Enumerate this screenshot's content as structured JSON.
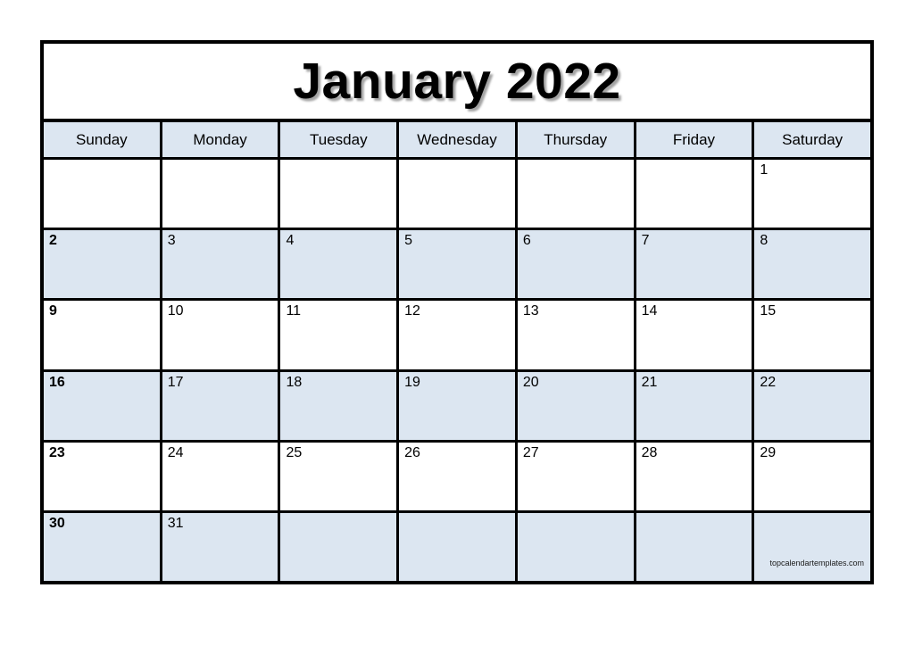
{
  "calendar": {
    "title": "January 2022",
    "month": "January",
    "year": "2022",
    "weekday_headers": [
      "Sunday",
      "Monday",
      "Tuesday",
      "Wednesday",
      "Thursday",
      "Friday",
      "Saturday"
    ],
    "weeks": [
      {
        "shaded": false,
        "days": [
          "",
          "",
          "",
          "",
          "",
          "",
          "1"
        ]
      },
      {
        "shaded": true,
        "days": [
          "2",
          "3",
          "4",
          "5",
          "6",
          "7",
          "8"
        ]
      },
      {
        "shaded": false,
        "days": [
          "9",
          "10",
          "11",
          "12",
          "13",
          "14",
          "15"
        ]
      },
      {
        "shaded": true,
        "days": [
          "16",
          "17",
          "18",
          "19",
          "20",
          "21",
          "22"
        ]
      },
      {
        "shaded": false,
        "days": [
          "23",
          "24",
          "25",
          "26",
          "27",
          "28",
          "29"
        ]
      },
      {
        "shaded": true,
        "days": [
          "30",
          "31",
          "",
          "",
          "",
          "",
          ""
        ]
      }
    ],
    "watermark": "topcalendartemplates.com",
    "colors": {
      "shaded_row": "#dce6f1",
      "header_row": "#dce6f1",
      "plain_row": "#ffffff",
      "border": "#000000",
      "text": "#000000",
      "page_background": "#ffffff"
    }
  }
}
